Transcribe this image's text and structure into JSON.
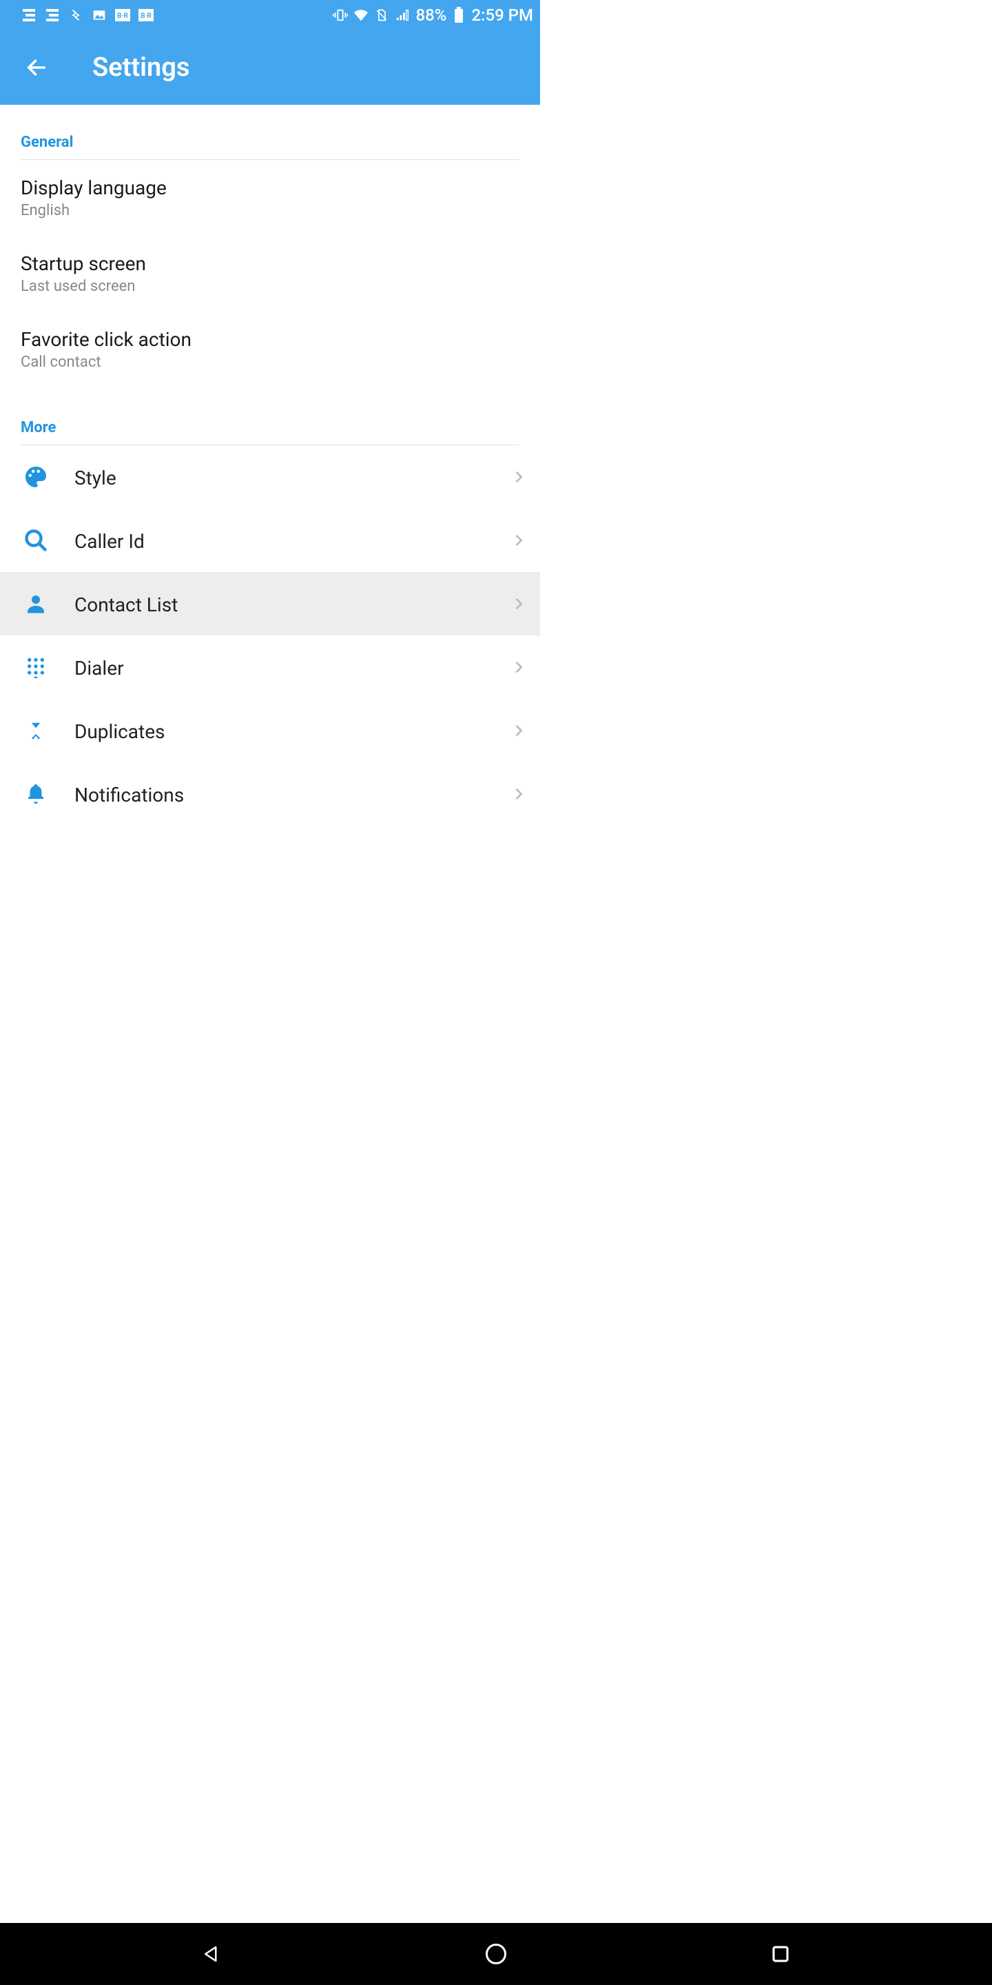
{
  "statusBar": {
    "battery": "88%",
    "time": "2:59 PM"
  },
  "appBar": {
    "title": "Settings"
  },
  "sections": {
    "general": {
      "header": "General",
      "items": [
        {
          "title": "Display language",
          "sub": "English"
        },
        {
          "title": "Startup screen",
          "sub": "Last used screen"
        },
        {
          "title": "Favorite click action",
          "sub": "Call contact"
        }
      ]
    },
    "more": {
      "header": "More",
      "items": [
        {
          "label": "Style",
          "icon": "palette"
        },
        {
          "label": "Caller Id",
          "icon": "search"
        },
        {
          "label": "Contact List",
          "icon": "person",
          "highlight": true
        },
        {
          "label": "Dialer",
          "icon": "dialpad"
        },
        {
          "label": "Duplicates",
          "icon": "merge"
        },
        {
          "label": "Notifications",
          "icon": "bell"
        }
      ]
    }
  }
}
